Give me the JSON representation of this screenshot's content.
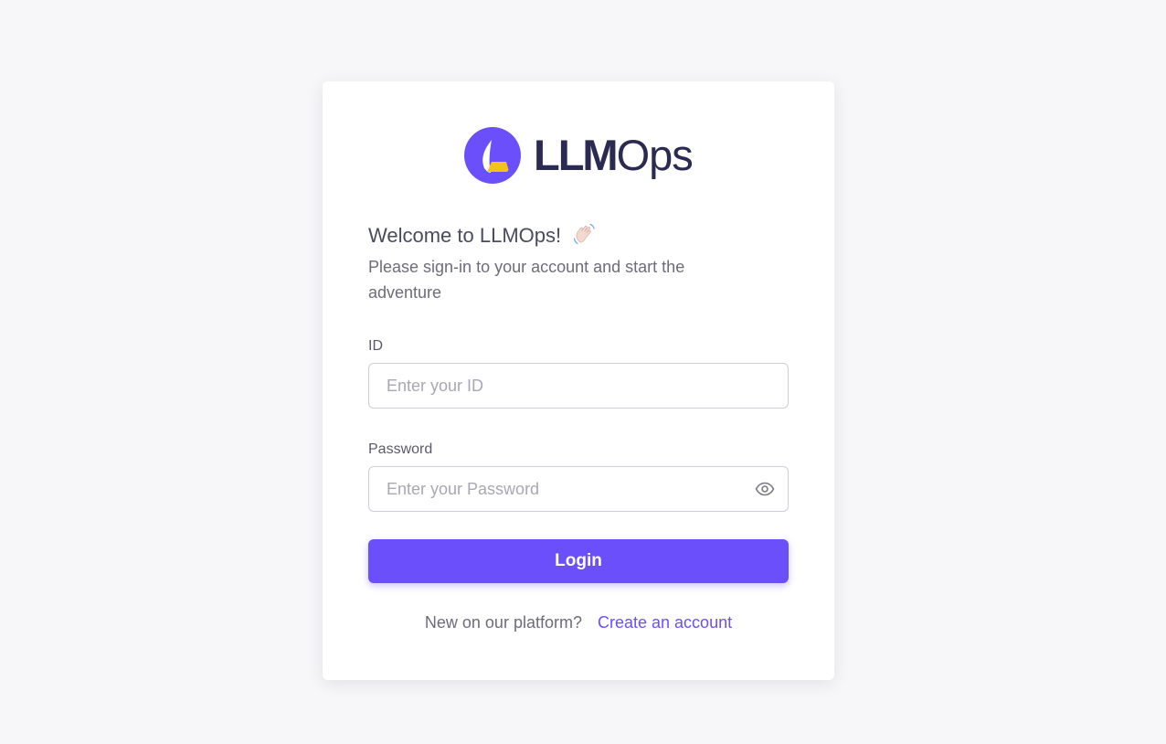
{
  "brand": {
    "name_bold": "LLM",
    "name_light": "Ops",
    "logo_colors": {
      "circle": "#6a4ffb",
      "leaf_top": "#ffffff",
      "leaf_bottom": "#f5c21b"
    }
  },
  "welcome": {
    "title": "Welcome to LLMOps!",
    "emoji_icon": "waving-hand-icon",
    "subtitle": "Please sign-in to your account and start the adventure"
  },
  "form": {
    "id_label": "ID",
    "id_placeholder": "Enter your ID",
    "id_value": "",
    "password_label": "Password",
    "password_placeholder": "Enter your Password",
    "password_value": "",
    "password_toggle_icon": "eye-icon",
    "login_label": "Login"
  },
  "footer": {
    "question": "New on our platform?",
    "create_link": "Create an account"
  },
  "colors": {
    "accent": "#6a4ffb",
    "background": "#f7f7f9",
    "card": "#ffffff"
  }
}
